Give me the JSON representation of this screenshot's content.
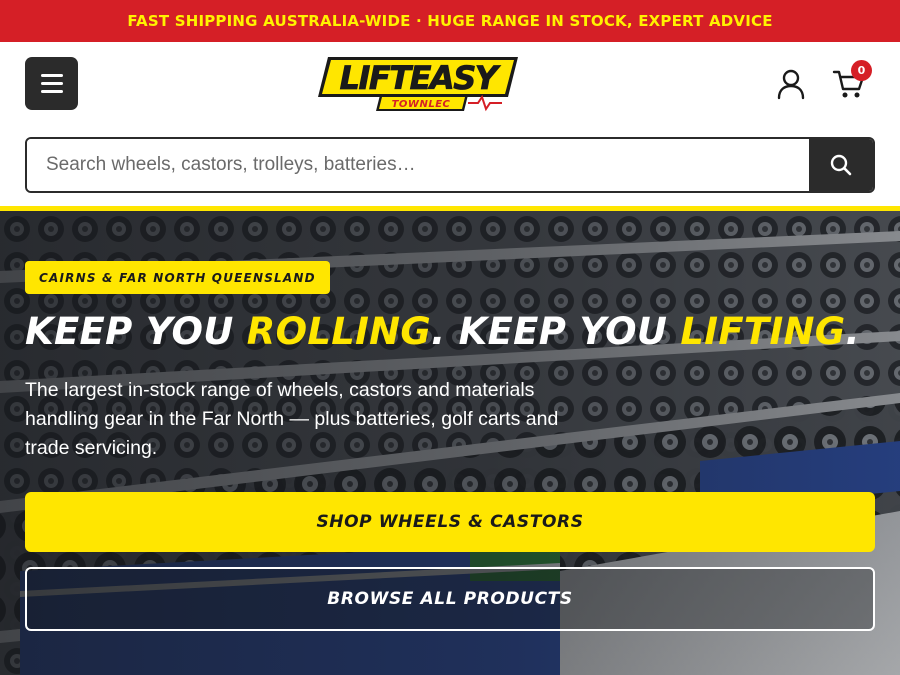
{
  "promo": {
    "text": "FAST SHIPPING AUSTRALIA-WIDE · HUGE RANGE IN STOCK, EXPERT ADVICE"
  },
  "header": {
    "logo_main": "LIFTEASY",
    "logo_sub": "TOWNLEC",
    "cart_count": "0",
    "icons": {
      "menu": "menu-icon",
      "account": "user-icon",
      "cart": "cart-icon"
    }
  },
  "search": {
    "placeholder": "Search wheels, castors, trolleys, batteries…",
    "value": "",
    "icon": "search-icon"
  },
  "hero": {
    "region_badge": "CAIRNS & FAR NORTH QUEENSLAND",
    "title_part1": "KEEP YOU ",
    "title_accent1": "ROLLING",
    "title_part2": ". KEEP YOU ",
    "title_accent2": "LIFTING",
    "title_part3": ".",
    "description": "The largest in-stock range of wheels, castors and materials handling gear in the Far North — plus batteries, golf carts and trade servicing.",
    "primary_cta": "SHOP WHEELS & CASTORS",
    "secondary_cta": "BROWSE ALL PRODUCTS"
  },
  "colors": {
    "brand_red": "#d51f26",
    "brand_yellow": "#ffe600",
    "dark": "#2b2b2b",
    "white": "#ffffff"
  }
}
